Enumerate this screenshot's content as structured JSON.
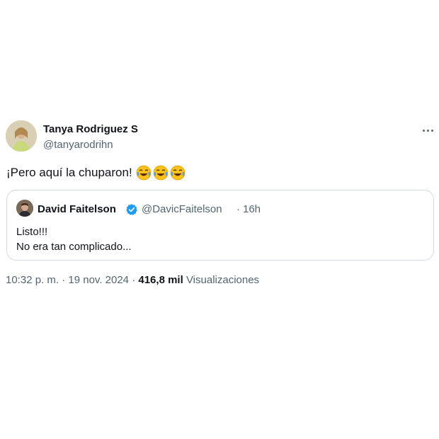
{
  "author": {
    "name": "Tanya Rodriguez S",
    "handle": "@tanyarodrihn"
  },
  "tweet": {
    "text": "¡Pero aquí la chuparon!",
    "emojis": [
      "face-with-tears-of-joy",
      "face-with-tears-of-joy",
      "face-with-tears-of-joy"
    ]
  },
  "quoted": {
    "name": "David Faitelson",
    "handle": "@DavicFaitelson",
    "separator": "·",
    "time": "16h",
    "lines": [
      "Listo!!!",
      "No era tan complicado..."
    ],
    "verified_color": "#1d9bf0"
  },
  "meta": {
    "time": "10:32 p. m.",
    "separator1": "·",
    "date": "19 nov. 2024",
    "separator2": "·",
    "views_count": "416,8 mil",
    "views_label": "Visualizaciones"
  },
  "colors": {
    "text": "#0f1419",
    "secondary": "#536471",
    "border": "#cfd9de"
  }
}
